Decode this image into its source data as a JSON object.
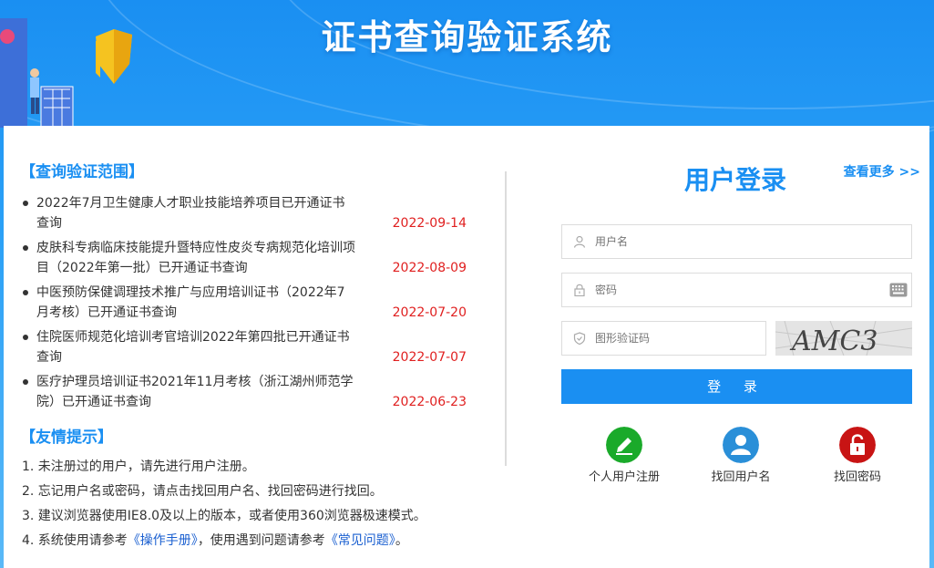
{
  "header": {
    "title": "证书查询验证系统"
  },
  "scope": {
    "title": "【查询验证范围】",
    "more_label": "查看更多 >>",
    "items": [
      {
        "text": "2022年7月卫生健康人才职业技能培养项目已开通证书查询",
        "date": "2022-09-14"
      },
      {
        "text": "皮肤科专病临床技能提升暨特应性皮炎专病规范化培训项目（2022年第一批）已开通证书查询",
        "date": "2022-08-09"
      },
      {
        "text": "中医预防保健调理技术推广与应用培训证书（2022年7月考核）已开通证书查询",
        "date": "2022-07-20"
      },
      {
        "text": "住院医师规范化培训考官培训2022年第四批已开通证书查询",
        "date": "2022-07-07"
      },
      {
        "text": "医疗护理员培训证书2021年11月考核（浙江湖州师范学院）已开通证书查询",
        "date": "2022-06-23"
      }
    ]
  },
  "tips": {
    "title": "【友情提示】",
    "items": [
      "1. 未注册过的用户，请先进行用户注册。",
      "2. 忘记用户名或密码，请点击找回用户名、找回密码进行找回。",
      "3. 建议浏览器使用IE8.0及以上的版本，或者使用360浏览器极速模式。"
    ],
    "item4_prefix": "4. 系统使用请参考",
    "item4_link1": "《操作手册》",
    "item4_middle": "，使用遇到问题请参考",
    "item4_link2": "《常见问题》",
    "item4_suffix": "。"
  },
  "login": {
    "title": "用户登录",
    "username_placeholder": "用户名",
    "password_placeholder": "密码",
    "captcha_placeholder": "图形验证码",
    "captcha_text": "AMC3",
    "submit_label": "登 录",
    "register_label": "个人用户注册",
    "find_username_label": "找回用户名",
    "find_password_label": "找回密码"
  },
  "colors": {
    "accent": "#1a8ff2",
    "date": "#e02020",
    "register_icon": "#1aaa2a",
    "find_username_icon": "#2a8fd8",
    "find_password_icon": "#c81414"
  }
}
